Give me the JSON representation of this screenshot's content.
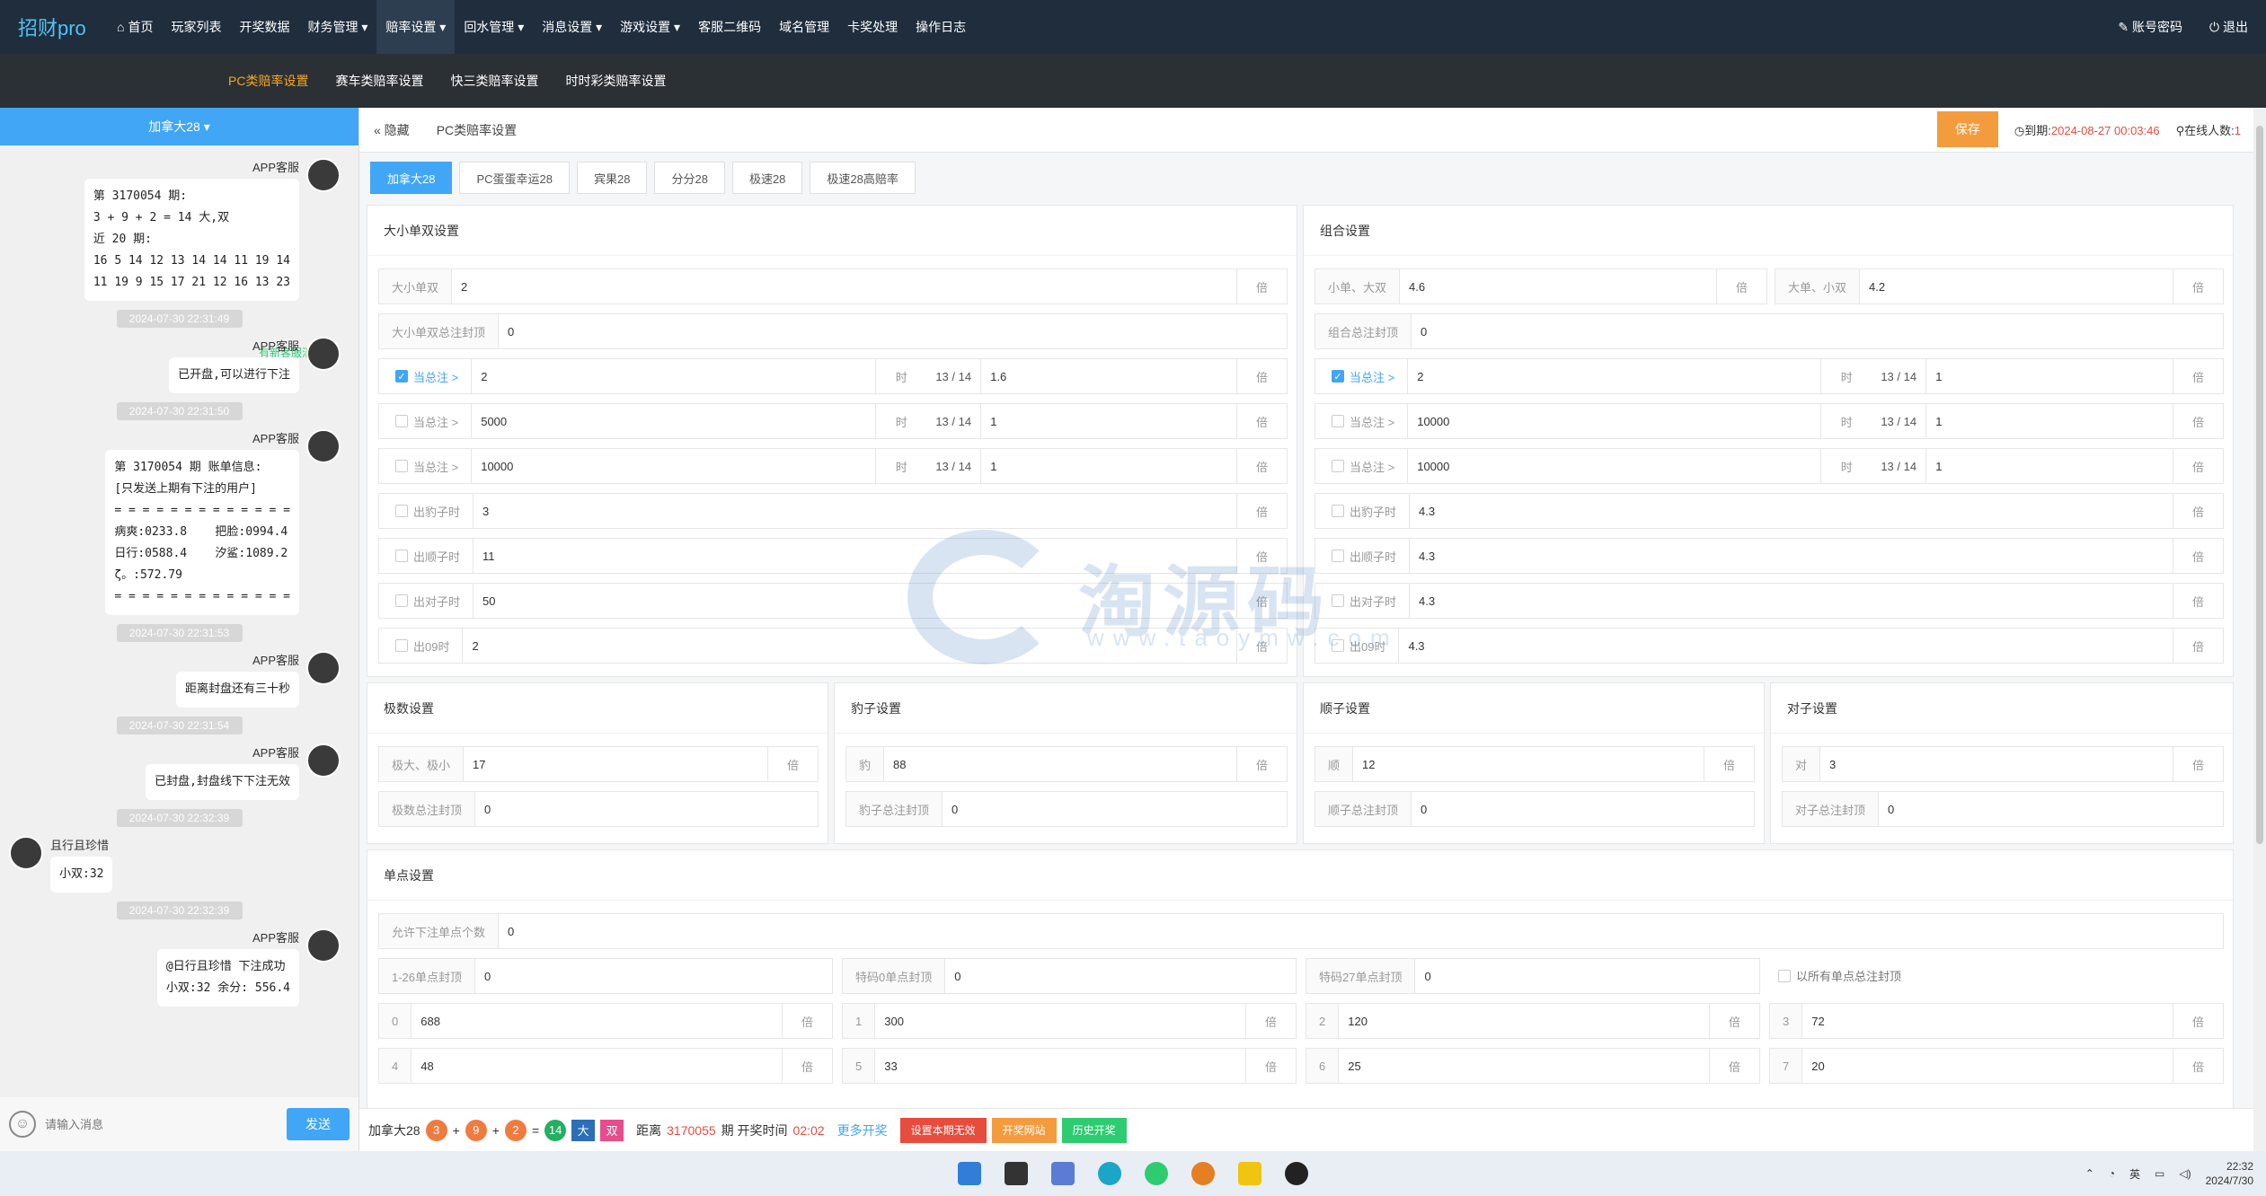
{
  "app": {
    "brand": "招财pro"
  },
  "topnav": [
    {
      "label": "首页",
      "icon": "home-icon"
    },
    {
      "label": "玩家列表"
    },
    {
      "label": "开奖数据"
    },
    {
      "label": "财务管理 ▾"
    },
    {
      "label": "赔率设置 ▾"
    },
    {
      "label": "回水管理 ▾"
    },
    {
      "label": "消息设置 ▾"
    },
    {
      "label": "游戏设置 ▾"
    },
    {
      "label": "客服二维码"
    },
    {
      "label": "域名管理"
    },
    {
      "label": "卡奖处理"
    },
    {
      "label": "操作日志"
    }
  ],
  "topright": {
    "account": "账号密码",
    "logout": "退出"
  },
  "subnav": [
    {
      "label": "PC类赔率设置"
    },
    {
      "label": "赛车类赔率设置"
    },
    {
      "label": "快三类赔率设置"
    },
    {
      "label": "时时彩类赔率设置"
    }
  ],
  "chat": {
    "room": "加拿大28 ▾",
    "new_msg": "有新客服消息GO",
    "placeholder": "请输入消息",
    "send": "发送",
    "messages": [
      {
        "ts": "2024-07-30 22:31:49",
        "who": "APP客服",
        "text": "第 3170054 期:\n3 + 9 + 2 = 14 大,双\n近 20 期:\n16 5 14 12 13 14 14 11 19 14\n11 19 9 15 17 21 12 16 13 23"
      },
      {
        "ts": "2024-07-30 22:31:49",
        "who": "APP客服",
        "text": "已开盘,可以进行下注"
      },
      {
        "ts": "2024-07-30 22:31:50",
        "who": "APP客服",
        "text": "第 3170054 期 账单信息:\n[只发送上期有下注的用户]\n= = = = = = = = = = = = =\n病爽:0233.8    把脸:0994.4\n日行:0588.4    汐鲨:1089.2\nζ。:572.79\n= = = = = = = = = = = = ="
      },
      {
        "ts": "2024-07-30 22:31:53",
        "who": "APP客服",
        "text": "距离封盘还有三十秒"
      },
      {
        "ts": "2024-07-30 22:31:54",
        "who": "APP客服",
        "text": "已封盘,封盘线下下注无效"
      },
      {
        "ts": "2024-07-30 22:32:39",
        "who": "且行且珍惜",
        "text": "小双:32"
      },
      {
        "ts": "2024-07-30 22:32:39",
        "who": "APP客服",
        "text": "@日行且珍惜 下注成功\n小双:32 余分: 556.4"
      }
    ]
  },
  "crumb": {
    "hide": "« 隐藏",
    "page": "PC类赔率设置",
    "save": "保存",
    "expire_label": "到期:",
    "expire": "2024-08-27 00:03:46",
    "online_label": "在线人数:",
    "online": "1"
  },
  "tabs": [
    "加拿大28",
    "PC蛋蛋幸运28",
    "宾果28",
    "分分28",
    "极速28",
    "极速28高赔率"
  ],
  "big_small": {
    "title": "大小单双设置",
    "row1": {
      "label": "大小单双",
      "value": "2",
      "suffix": "倍"
    },
    "row2": {
      "label": "大小单双总注封顶",
      "value": "0"
    },
    "conds": [
      {
        "label": "当总注 >",
        "value": "2",
        "when": "时",
        "mid": "13 / 14",
        "value2": "1.6",
        "suffix": "倍",
        "checked": true
      },
      {
        "label": "当总注 >",
        "value": "5000",
        "when": "时",
        "mid": "13 / 14",
        "value2": "1",
        "suffix": "倍",
        "checked": false
      },
      {
        "label": "当总注 >",
        "value": "10000",
        "when": "时",
        "mid": "13 / 14",
        "value2": "1",
        "suffix": "倍",
        "checked": false
      }
    ],
    "extras": [
      {
        "label": "出豹子时",
        "value": "3",
        "suffix": "倍"
      },
      {
        "label": "出顺子时",
        "value": "11",
        "suffix": "倍"
      },
      {
        "label": "出对子时",
        "value": "50",
        "suffix": "倍"
      },
      {
        "label": "出09时",
        "value": "2",
        "suffix": "倍"
      }
    ]
  },
  "combo": {
    "title": "组合设置",
    "row1a": {
      "label": "小单、大双",
      "value": "4.6",
      "suffix": "倍"
    },
    "row1b": {
      "label": "大单、小双",
      "value": "4.2",
      "suffix": "倍"
    },
    "row2": {
      "label": "组合总注封顶",
      "value": "0"
    },
    "conds": [
      {
        "label": "当总注 >",
        "value": "2",
        "when": "时",
        "mid": "13 / 14",
        "value2": "1",
        "suffix": "倍",
        "checked": true
      },
      {
        "label": "当总注 >",
        "value": "10000",
        "when": "时",
        "mid": "13 / 14",
        "value2": "1",
        "suffix": "倍",
        "checked": false
      },
      {
        "label": "当总注 >",
        "value": "10000",
        "when": "时",
        "mid": "13 / 14",
        "value2": "1",
        "suffix": "倍",
        "checked": false
      }
    ],
    "extras": [
      {
        "label": "出豹子时",
        "value": "4.3",
        "suffix": "倍"
      },
      {
        "label": "出顺子时",
        "value": "4.3",
        "suffix": "倍"
      },
      {
        "label": "出对子时",
        "value": "4.3",
        "suffix": "倍"
      },
      {
        "label": "出09时",
        "value": "4.3",
        "suffix": "倍"
      }
    ]
  },
  "extreme": {
    "title": "极数设置",
    "row1": {
      "label": "极大、极小",
      "value": "17",
      "suffix": "倍"
    },
    "row2": {
      "label": "极数总注封顶",
      "value": "0"
    }
  },
  "leopard": {
    "title": "豹子设置",
    "row1": {
      "label": "豹",
      "value": "88",
      "suffix": "倍"
    },
    "row2": {
      "label": "豹子总注封顶",
      "value": "0"
    }
  },
  "straight": {
    "title": "顺子设置",
    "row1": {
      "label": "顺",
      "value": "12",
      "suffix": "倍"
    },
    "row2": {
      "label": "顺子总注封顶",
      "value": "0"
    }
  },
  "pair": {
    "title": "对子设置",
    "row1": {
      "label": "对",
      "value": "3",
      "suffix": "倍"
    },
    "row2": {
      "label": "对子总注封顶",
      "value": "0"
    }
  },
  "single": {
    "title": "单点设置",
    "allow": {
      "label": "允许下注单点个数",
      "value": "0"
    },
    "cap1": {
      "label": "1-26单点封顶",
      "value": "0"
    },
    "cap2": {
      "label": "特码0单点封顶",
      "value": "0"
    },
    "cap3": {
      "label": "特码27单点封顶",
      "value": "0"
    },
    "all_cap": "以所有单点总注封顶",
    "points": [
      {
        "n": "0",
        "v": "688",
        "s": "倍"
      },
      {
        "n": "1",
        "v": "300",
        "s": "倍"
      },
      {
        "n": "2",
        "v": "120",
        "s": "倍"
      },
      {
        "n": "3",
        "v": "72",
        "s": "倍"
      },
      {
        "n": "4",
        "v": "48",
        "s": "倍"
      },
      {
        "n": "5",
        "v": "33",
        "s": "倍"
      },
      {
        "n": "6",
        "v": "25",
        "s": "倍"
      },
      {
        "n": "7",
        "v": "20",
        "s": "倍"
      }
    ]
  },
  "status": {
    "game": "加拿大28",
    "balls": [
      "3",
      "9",
      "2"
    ],
    "sum": "14",
    "big": "大",
    "even": "双",
    "dist_label": "距离",
    "issue": "3170055",
    "time_label": "期 开奖时间",
    "time": "02:02",
    "more": "更多开奖",
    "btn1": "设置本期无效",
    "btn2": "开奖网站",
    "btn3": "历史开奖"
  },
  "taskbar": {
    "lang": "英",
    "time": "22:32",
    "date": "2024/7/30"
  },
  "watermark": {
    "text": "淘源码",
    "url": "www.taoymw.com"
  }
}
